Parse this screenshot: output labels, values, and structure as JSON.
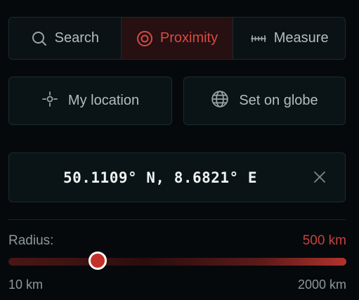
{
  "tabs": [
    {
      "label": "Search",
      "icon": "search-icon",
      "active": false
    },
    {
      "label": "Proximity",
      "icon": "target-icon",
      "active": true
    },
    {
      "label": "Measure",
      "icon": "ruler-icon",
      "active": false
    }
  ],
  "location_buttons": {
    "my_location": {
      "label": "My location",
      "icon": "crosshair-icon"
    },
    "set_on_globe": {
      "label": "Set on globe",
      "icon": "globe-icon"
    }
  },
  "coordinates": {
    "value": "50.1109° N, 8.6821° E",
    "clear_icon": "close-icon"
  },
  "radius": {
    "label": "Radius:",
    "value_label": "500 km",
    "slider_fraction": 0.263,
    "min_label": "10 km",
    "max_label": "2000 km"
  },
  "colors": {
    "accent": "#d84a43",
    "background": "#06090b",
    "border": "#1b2b2e",
    "text": "#b3bcbe"
  }
}
